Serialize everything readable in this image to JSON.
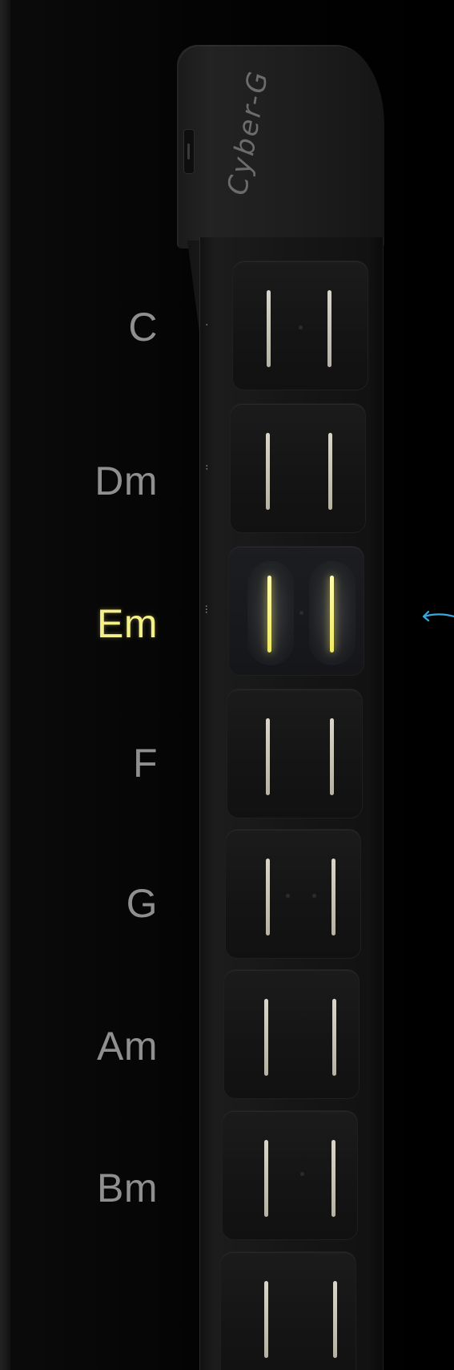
{
  "brand": {
    "logo_text": "Cyber-G"
  },
  "chords": [
    {
      "label": "C",
      "active": false
    },
    {
      "label": "Dm",
      "active": false
    },
    {
      "label": "Em",
      "active": true
    },
    {
      "label": "F",
      "active": false
    },
    {
      "label": "G",
      "active": false
    },
    {
      "label": "Am",
      "active": false
    },
    {
      "label": "Bm",
      "active": false
    }
  ],
  "colors": {
    "background": "#000000",
    "chord_inactive": "#8f8f8f",
    "chord_active": "#f4f08a",
    "string_lit": "#f1eb62",
    "arrow": "#3aa8e0"
  },
  "icons": {
    "pointer": "arrow-left-icon"
  }
}
